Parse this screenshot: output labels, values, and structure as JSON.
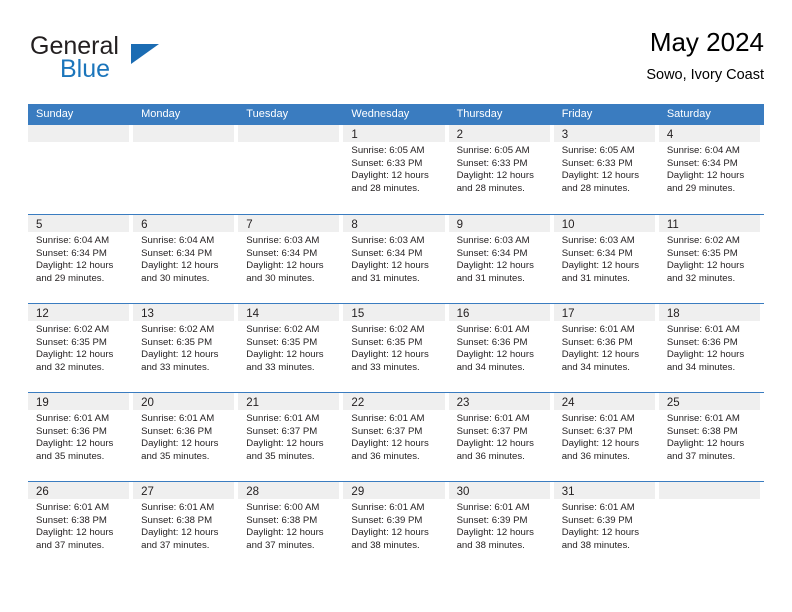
{
  "brand": {
    "name_part1": "General",
    "name_part2": "Blue",
    "triangle_icon": "blue-triangle-icon",
    "color_dark": "#231f20",
    "color_blue": "#1b75bb"
  },
  "header": {
    "title": "May 2024",
    "subtitle": "Sowo, Ivory Coast"
  },
  "theme": {
    "header_blue": "#3a7cc0",
    "daynum_band": "#efefef",
    "text": "#231f20"
  },
  "weekdays": [
    "Sunday",
    "Monday",
    "Tuesday",
    "Wednesday",
    "Thursday",
    "Friday",
    "Saturday"
  ],
  "weeks": [
    [
      {
        "day": "",
        "sunrise": "",
        "sunset": "",
        "daylight1": "",
        "daylight2": ""
      },
      {
        "day": "",
        "sunrise": "",
        "sunset": "",
        "daylight1": "",
        "daylight2": ""
      },
      {
        "day": "",
        "sunrise": "",
        "sunset": "",
        "daylight1": "",
        "daylight2": ""
      },
      {
        "day": "1",
        "sunrise": "Sunrise: 6:05 AM",
        "sunset": "Sunset: 6:33 PM",
        "daylight1": "Daylight: 12 hours",
        "daylight2": "and 28 minutes."
      },
      {
        "day": "2",
        "sunrise": "Sunrise: 6:05 AM",
        "sunset": "Sunset: 6:33 PM",
        "daylight1": "Daylight: 12 hours",
        "daylight2": "and 28 minutes."
      },
      {
        "day": "3",
        "sunrise": "Sunrise: 6:05 AM",
        "sunset": "Sunset: 6:33 PM",
        "daylight1": "Daylight: 12 hours",
        "daylight2": "and 28 minutes."
      },
      {
        "day": "4",
        "sunrise": "Sunrise: 6:04 AM",
        "sunset": "Sunset: 6:34 PM",
        "daylight1": "Daylight: 12 hours",
        "daylight2": "and 29 minutes."
      }
    ],
    [
      {
        "day": "5",
        "sunrise": "Sunrise: 6:04 AM",
        "sunset": "Sunset: 6:34 PM",
        "daylight1": "Daylight: 12 hours",
        "daylight2": "and 29 minutes."
      },
      {
        "day": "6",
        "sunrise": "Sunrise: 6:04 AM",
        "sunset": "Sunset: 6:34 PM",
        "daylight1": "Daylight: 12 hours",
        "daylight2": "and 30 minutes."
      },
      {
        "day": "7",
        "sunrise": "Sunrise: 6:03 AM",
        "sunset": "Sunset: 6:34 PM",
        "daylight1": "Daylight: 12 hours",
        "daylight2": "and 30 minutes."
      },
      {
        "day": "8",
        "sunrise": "Sunrise: 6:03 AM",
        "sunset": "Sunset: 6:34 PM",
        "daylight1": "Daylight: 12 hours",
        "daylight2": "and 31 minutes."
      },
      {
        "day": "9",
        "sunrise": "Sunrise: 6:03 AM",
        "sunset": "Sunset: 6:34 PM",
        "daylight1": "Daylight: 12 hours",
        "daylight2": "and 31 minutes."
      },
      {
        "day": "10",
        "sunrise": "Sunrise: 6:03 AM",
        "sunset": "Sunset: 6:34 PM",
        "daylight1": "Daylight: 12 hours",
        "daylight2": "and 31 minutes."
      },
      {
        "day": "11",
        "sunrise": "Sunrise: 6:02 AM",
        "sunset": "Sunset: 6:35 PM",
        "daylight1": "Daylight: 12 hours",
        "daylight2": "and 32 minutes."
      }
    ],
    [
      {
        "day": "12",
        "sunrise": "Sunrise: 6:02 AM",
        "sunset": "Sunset: 6:35 PM",
        "daylight1": "Daylight: 12 hours",
        "daylight2": "and 32 minutes."
      },
      {
        "day": "13",
        "sunrise": "Sunrise: 6:02 AM",
        "sunset": "Sunset: 6:35 PM",
        "daylight1": "Daylight: 12 hours",
        "daylight2": "and 33 minutes."
      },
      {
        "day": "14",
        "sunrise": "Sunrise: 6:02 AM",
        "sunset": "Sunset: 6:35 PM",
        "daylight1": "Daylight: 12 hours",
        "daylight2": "and 33 minutes."
      },
      {
        "day": "15",
        "sunrise": "Sunrise: 6:02 AM",
        "sunset": "Sunset: 6:35 PM",
        "daylight1": "Daylight: 12 hours",
        "daylight2": "and 33 minutes."
      },
      {
        "day": "16",
        "sunrise": "Sunrise: 6:01 AM",
        "sunset": "Sunset: 6:36 PM",
        "daylight1": "Daylight: 12 hours",
        "daylight2": "and 34 minutes."
      },
      {
        "day": "17",
        "sunrise": "Sunrise: 6:01 AM",
        "sunset": "Sunset: 6:36 PM",
        "daylight1": "Daylight: 12 hours",
        "daylight2": "and 34 minutes."
      },
      {
        "day": "18",
        "sunrise": "Sunrise: 6:01 AM",
        "sunset": "Sunset: 6:36 PM",
        "daylight1": "Daylight: 12 hours",
        "daylight2": "and 34 minutes."
      }
    ],
    [
      {
        "day": "19",
        "sunrise": "Sunrise: 6:01 AM",
        "sunset": "Sunset: 6:36 PM",
        "daylight1": "Daylight: 12 hours",
        "daylight2": "and 35 minutes."
      },
      {
        "day": "20",
        "sunrise": "Sunrise: 6:01 AM",
        "sunset": "Sunset: 6:36 PM",
        "daylight1": "Daylight: 12 hours",
        "daylight2": "and 35 minutes."
      },
      {
        "day": "21",
        "sunrise": "Sunrise: 6:01 AM",
        "sunset": "Sunset: 6:37 PM",
        "daylight1": "Daylight: 12 hours",
        "daylight2": "and 35 minutes."
      },
      {
        "day": "22",
        "sunrise": "Sunrise: 6:01 AM",
        "sunset": "Sunset: 6:37 PM",
        "daylight1": "Daylight: 12 hours",
        "daylight2": "and 36 minutes."
      },
      {
        "day": "23",
        "sunrise": "Sunrise: 6:01 AM",
        "sunset": "Sunset: 6:37 PM",
        "daylight1": "Daylight: 12 hours",
        "daylight2": "and 36 minutes."
      },
      {
        "day": "24",
        "sunrise": "Sunrise: 6:01 AM",
        "sunset": "Sunset: 6:37 PM",
        "daylight1": "Daylight: 12 hours",
        "daylight2": "and 36 minutes."
      },
      {
        "day": "25",
        "sunrise": "Sunrise: 6:01 AM",
        "sunset": "Sunset: 6:38 PM",
        "daylight1": "Daylight: 12 hours",
        "daylight2": "and 37 minutes."
      }
    ],
    [
      {
        "day": "26",
        "sunrise": "Sunrise: 6:01 AM",
        "sunset": "Sunset: 6:38 PM",
        "daylight1": "Daylight: 12 hours",
        "daylight2": "and 37 minutes."
      },
      {
        "day": "27",
        "sunrise": "Sunrise: 6:01 AM",
        "sunset": "Sunset: 6:38 PM",
        "daylight1": "Daylight: 12 hours",
        "daylight2": "and 37 minutes."
      },
      {
        "day": "28",
        "sunrise": "Sunrise: 6:00 AM",
        "sunset": "Sunset: 6:38 PM",
        "daylight1": "Daylight: 12 hours",
        "daylight2": "and 37 minutes."
      },
      {
        "day": "29",
        "sunrise": "Sunrise: 6:01 AM",
        "sunset": "Sunset: 6:39 PM",
        "daylight1": "Daylight: 12 hours",
        "daylight2": "and 38 minutes."
      },
      {
        "day": "30",
        "sunrise": "Sunrise: 6:01 AM",
        "sunset": "Sunset: 6:39 PM",
        "daylight1": "Daylight: 12 hours",
        "daylight2": "and 38 minutes."
      },
      {
        "day": "31",
        "sunrise": "Sunrise: 6:01 AM",
        "sunset": "Sunset: 6:39 PM",
        "daylight1": "Daylight: 12 hours",
        "daylight2": "and 38 minutes."
      },
      {
        "day": "",
        "sunrise": "",
        "sunset": "",
        "daylight1": "",
        "daylight2": ""
      }
    ]
  ]
}
